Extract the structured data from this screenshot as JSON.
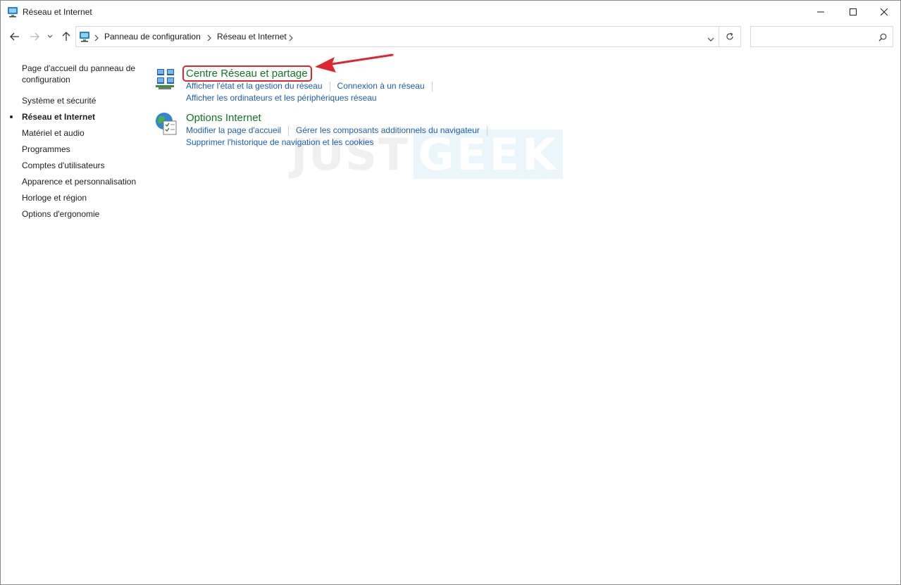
{
  "window": {
    "title": "Réseau et Internet"
  },
  "navbar": {
    "breadcrumbs": [
      "Panneau de configuration",
      "Réseau et Internet"
    ],
    "search": {
      "placeholder": "",
      "value": ""
    }
  },
  "sidebar": {
    "home": "Page d'accueil du panneau de configuration",
    "items": [
      {
        "label": "Système et sécurité",
        "active": false
      },
      {
        "label": "Réseau et Internet",
        "active": true
      },
      {
        "label": "Matériel et audio",
        "active": false
      },
      {
        "label": "Programmes",
        "active": false
      },
      {
        "label": "Comptes d'utilisateurs",
        "active": false
      },
      {
        "label": "Apparence et personnalisation",
        "active": false
      },
      {
        "label": "Horloge et région",
        "active": false
      },
      {
        "label": "Options d'ergonomie",
        "active": false
      }
    ]
  },
  "sections": [
    {
      "title": "Centre Réseau et partage",
      "icon": "network-center-icon",
      "links": [
        "Afficher l'état et la gestion du réseau",
        "Connexion à un réseau",
        "Afficher les ordinateurs et les périphériques réseau"
      ]
    },
    {
      "title": "Options Internet",
      "icon": "internet-options-icon",
      "links": [
        "Modifier la page d'accueil",
        "Gérer les composants additionnels du navigateur",
        "Supprimer l'historique de navigation et les cookies"
      ]
    }
  ],
  "watermark": {
    "part1": "JUST",
    "part2": "GEEK"
  },
  "colors": {
    "title_green": "#0b7a1e",
    "link_blue": "#1a5fb4",
    "annotation_red": "#e0252d"
  }
}
